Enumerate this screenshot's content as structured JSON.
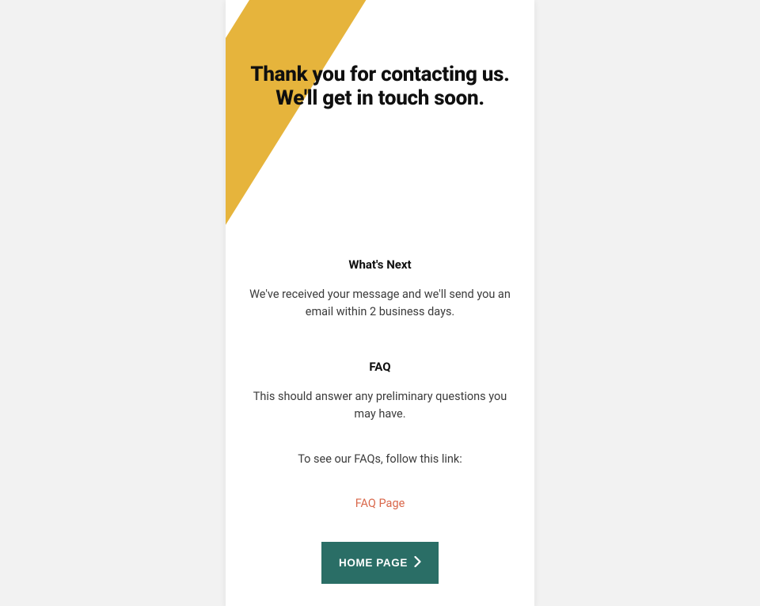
{
  "headline": "Thank you for contacting us. We'll get in touch soon.",
  "sections": {
    "whatsNext": {
      "title": "What's Next",
      "body": "We've received your message and we'll send you an email within 2 business days."
    },
    "faq": {
      "title": "FAQ",
      "intro": "This should answer any preliminary questions you may have.",
      "follow": "To see our FAQs, follow this link:",
      "linkLabel": "FAQ Page"
    }
  },
  "homeButton": {
    "label": "HOME PAGE"
  },
  "colors": {
    "accent": "#e6b43c",
    "link": "#d9674a",
    "button": "#2a6e66"
  }
}
